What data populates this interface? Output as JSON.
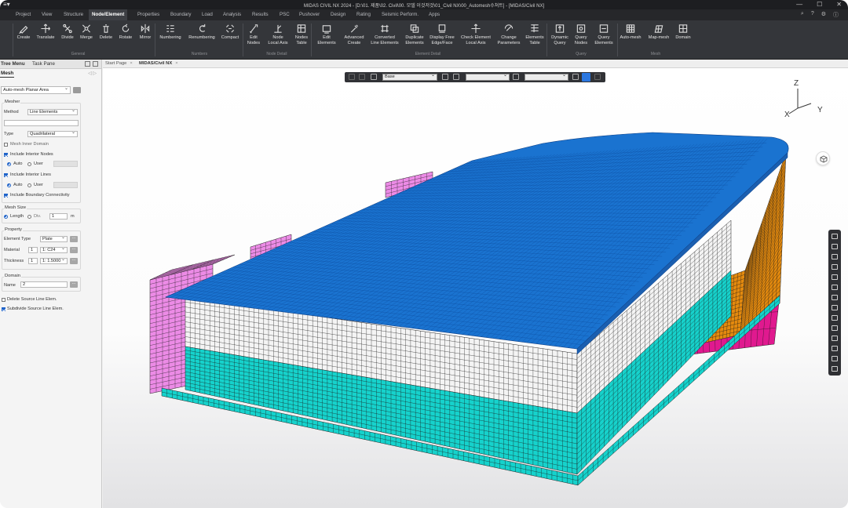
{
  "titlebar": {
    "app_menu": "≡▾",
    "title": "MIDAS CIVIL NX 2024 - [D:\\01. 제품\\02. Civil\\00. 모델 이것저것\\01_Civil NX\\00_Automesh수쳐트] - [MIDAS/Civil NX]",
    "minimize": "—",
    "maximize": "☐",
    "close": "✕"
  },
  "menu": {
    "tabs": [
      "Project",
      "View",
      "Structure",
      "Node/Element",
      "Properties",
      "Boundary",
      "Load",
      "Analysis",
      "Results",
      "PSC",
      "Pushover",
      "Design",
      "Rating",
      "Seismic Perform.",
      "Apps"
    ],
    "active": "Node/Element",
    "right_icons": [
      "search-icon",
      "help-icon",
      "settings-icon",
      "info-icon"
    ]
  },
  "ribbon": {
    "buttons": [
      {
        "label": "Create",
        "icon": "pencil-icon"
      },
      {
        "label": "Translate",
        "icon": "move-icon"
      },
      {
        "label": "Divide",
        "icon": "divide-icon"
      },
      {
        "label": "Merge",
        "icon": "merge-icon"
      },
      {
        "label": "Delete",
        "icon": "trash-icon"
      },
      {
        "label": "Rotate",
        "icon": "rotate-icon"
      },
      {
        "label": "Mirror",
        "icon": "mirror-icon"
      },
      {
        "label": "Numbering",
        "icon": "numbering-icon"
      },
      {
        "label": "Renumbering",
        "icon": "renumber-icon"
      },
      {
        "label": "Compact",
        "icon": "compact-icon"
      },
      {
        "label": "Edit\nNodes",
        "icon": "edit-nodes-icon"
      },
      {
        "label": "Node\nLocal Axis",
        "icon": "local-axis-icon"
      },
      {
        "label": "Nodes\nTable",
        "icon": "table-icon"
      },
      {
        "label": "Edit\nElements",
        "icon": "edit-elements-icon"
      },
      {
        "label": "Advanced\nCreate",
        "icon": "advanced-create-icon"
      },
      {
        "label": "Converted\nLine Elements",
        "icon": "convert-icon"
      },
      {
        "label": "Duplicate\nElements",
        "icon": "duplicate-icon"
      },
      {
        "label": "Display Free\nEdge/Face",
        "icon": "free-edge-icon"
      },
      {
        "label": "Check Element\nLocal Axis",
        "icon": "check-axis-icon"
      },
      {
        "label": "Change\nParameters",
        "icon": "parameters-icon"
      },
      {
        "label": "Elements\nTable",
        "icon": "table-icon"
      },
      {
        "label": "Dynamic\nQuery",
        "icon": "query-icon"
      },
      {
        "label": "Query\nNodes",
        "icon": "query-nodes-icon"
      },
      {
        "label": "Query\nElements",
        "icon": "query-elements-icon"
      },
      {
        "label": "Auto-mesh",
        "icon": "automesh-icon"
      },
      {
        "label": "Map-mesh",
        "icon": "mapmesh-icon"
      },
      {
        "label": "Domain",
        "icon": "domain-icon"
      }
    ],
    "groups": [
      "General",
      "Numbers",
      "Node Detail",
      "Element Detail",
      "Query",
      "Mesh"
    ]
  },
  "left_panel": {
    "tabs": [
      "Tree Menu",
      "Task Pane"
    ],
    "section_title": "Mesh",
    "header_controls": "◁ ▷",
    "command": "Auto-mesh Planar Area",
    "mesher": {
      "group_label": "Mesher",
      "method_label": "Method",
      "method_value": "Line Elements",
      "line_input": "",
      "type_label": "Type",
      "type_value": "Quadrilateral",
      "mesh_inner_domain": "Mesh Inner Domain",
      "include_interior_nodes": "Include Interior Nodes",
      "include_interior_lines": "Include Interior Lines",
      "auto": "Auto",
      "user": "User",
      "include_boundary": "Include Boundary Connectivity"
    },
    "mesh_size": {
      "group_label": "Mesh Size",
      "length": "Length",
      "div": "Div.",
      "value": "1",
      "unit": "m"
    },
    "property": {
      "group_label": "Property",
      "element_type_label": "Element Type",
      "element_type": "Plate",
      "material_label": "Material",
      "material_id": "1",
      "material_name": "1: C24",
      "thickness_label": "Thickness",
      "thickness_id": "1",
      "thickness_name": "1: 1.5000",
      "more": "..."
    },
    "domain": {
      "group_label": "Domain",
      "name_label": "Name",
      "name_value": "2"
    },
    "delete_source": "Delete Source Line Elem.",
    "subdivide_source": "Subdivide Source Line Elem."
  },
  "doc_tabs": [
    {
      "label": "Start Page",
      "close": "×"
    },
    {
      "label": "MIDAS/Civil NX",
      "close": "×"
    }
  ],
  "viewport": {
    "view_selector": "Base",
    "select_2": "",
    "select_3": "",
    "axis_labels": {
      "z": "Z",
      "y": "Y",
      "x": "X"
    },
    "colors": {
      "deck_top": "#1a73d0",
      "deck_grid": "#0c4a9a",
      "wall_white": "#f4f4f4",
      "cyan": "#16d2cc",
      "orange": "#e48a0e",
      "magenta_light": "#ec8be6",
      "magenta": "#e0198f",
      "mesh_line": "#1a1a1a"
    }
  }
}
